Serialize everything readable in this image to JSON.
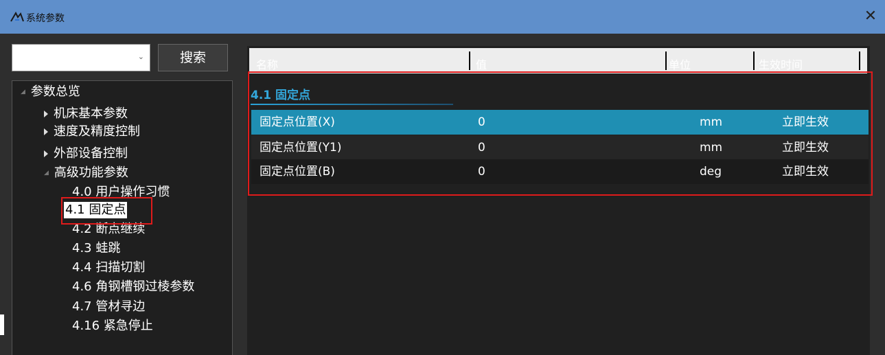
{
  "window": {
    "title": "系统参数",
    "close_glyph": "✕"
  },
  "search": {
    "placeholder": "",
    "value": "",
    "button_label": "搜索"
  },
  "tree": {
    "root": "参数总览",
    "items": [
      {
        "label": "机床基本参数",
        "expanded": false
      },
      {
        "label": "速度及精度控制",
        "expanded": false
      },
      {
        "label": "外部设备控制",
        "expanded": false
      },
      {
        "label": "高级功能参数",
        "expanded": true
      }
    ],
    "subitems": [
      "4.0 用户操作习惯",
      "4.1 固定点",
      "4.2 断点继续",
      "4.3 蛙跳",
      "4.4 扫描切割",
      "4.6 角钢槽钢过棱参数",
      "4.7 管材寻边",
      "4.16 紧急停止"
    ],
    "selected": "4.1 固定点"
  },
  "grid": {
    "columns": [
      "名称",
      "值",
      "单位",
      "生效时间"
    ],
    "group_title": "4.1 固定点",
    "rows": [
      {
        "name": "固定点位置(X)",
        "value": "0",
        "unit": "mm",
        "effect": "立即生效",
        "selected": true
      },
      {
        "name": "固定点位置(Y1)",
        "value": "0",
        "unit": "mm",
        "effect": "立即生效",
        "selected": false
      },
      {
        "name": "固定点位置(B)",
        "value": "0",
        "unit": "deg",
        "effect": "立即生效",
        "selected": false
      }
    ]
  },
  "colors": {
    "titlebar": "#5f8fcb",
    "selection": "#1f8fb3",
    "group_title": "#33a7db",
    "highlight_box": "#e01b1b"
  },
  "icons": {
    "app": "app-icon",
    "close": "close-icon",
    "dropdown": "chevron-down-icon",
    "expand": "triangle-right-icon"
  }
}
